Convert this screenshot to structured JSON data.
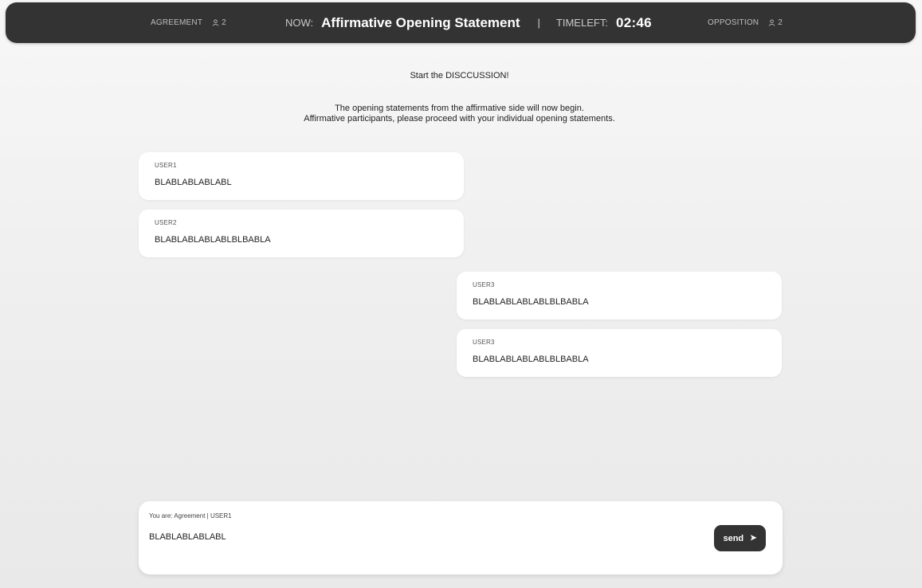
{
  "header": {
    "agreement_label": "AGREEMENT",
    "agreement_count": "2",
    "now_label": "NOW:",
    "now_title": "Affirmative Opening Statement",
    "separator": "|",
    "timeleft_label": "TIMELEFT:",
    "timeleft_value": "02:46",
    "opposition_label": "OPPOSITION",
    "opposition_count": "2",
    "user_icon": "person-icon"
  },
  "intro": {
    "start": "Start the DISCCUSSION!",
    "line1": "The opening statements from the affirmative side will now begin.",
    "line2": "Affirmative participants, please proceed with your individual opening statements."
  },
  "messages": [
    {
      "side": "left",
      "user": "USER1",
      "text": "BLABLABLABLABL"
    },
    {
      "side": "left",
      "user": "USER2",
      "text": "BLABLABLABLABLBLBABLA"
    },
    {
      "side": "right",
      "user": "USER3",
      "text": "BLABLABLABLABLBLBABLA"
    },
    {
      "side": "right",
      "user": "USER3",
      "text": "BLABLABLABLABLBLBABLA"
    }
  ],
  "composer": {
    "you_are": "You are: Agreement | USER1",
    "input_value": "BLABLABLABLABL",
    "send_label": "send",
    "send_icon": "➤"
  },
  "colors": {
    "bar": "#333333",
    "background": "#eeeeee",
    "card": "#ffffff"
  }
}
